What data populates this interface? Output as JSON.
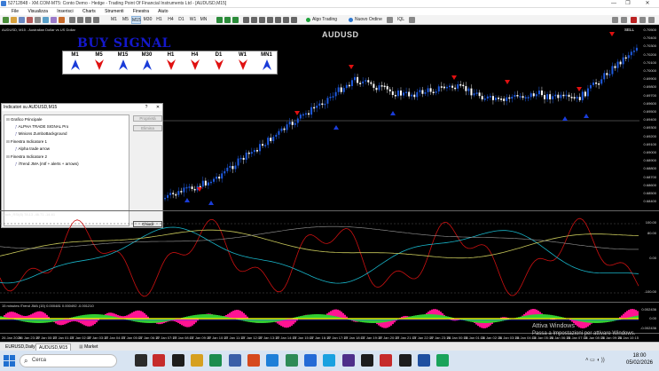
{
  "window": {
    "title": "52712848 - XM.COM-MT5: Conto Demo - Hedge - Trading Point Of Financial Instruments Ltd - [AUDUSD,M15]",
    "buttons": [
      "—",
      "❐",
      "✕"
    ]
  },
  "menu": [
    "File",
    "Visualizza",
    "Inserisci",
    "Charts",
    "Strumenti",
    "Finestra",
    "Aiuto"
  ],
  "toolbar": {
    "timeframes": [
      "M1",
      "M5",
      "M15",
      "M30",
      "H1",
      "H4",
      "D1",
      "W1",
      "MN"
    ],
    "active": "M15",
    "algo": "Algo Trading",
    "new_order": "Nuovo Ordine",
    "iql": "IQL"
  },
  "chart": {
    "title": "AUDUSD, M15 - Australian Dollar vs US Dollar",
    "watermark": "AUDUSD",
    "sell_label": "SELL",
    "buy_signal": "BUY SIGNAL",
    "prices": [
      "0.70500",
      "0.70400",
      "0.70300",
      "0.70200",
      "0.70100",
      "0.70000",
      "0.69900",
      "0.69800",
      "0.69700",
      "0.69600",
      "0.69500",
      "0.69400",
      "0.69300",
      "0.69200",
      "0.69100",
      "0.69000",
      "0.68900",
      "0.68800",
      "0.68700",
      "0.68600",
      "0.68500",
      "0.68400"
    ],
    "signal_tfs": [
      {
        "tf": "M1",
        "dir": "up"
      },
      {
        "tf": "M5",
        "dir": "down"
      },
      {
        "tf": "M15",
        "dir": "up"
      },
      {
        "tf": "M30",
        "dir": "up"
      },
      {
        "tf": "H1",
        "dir": "down"
      },
      {
        "tf": "H4",
        "dir": "down"
      },
      {
        "tf": "D1",
        "dir": "down"
      },
      {
        "tf": "W1",
        "dir": "down"
      },
      {
        "tf": "MN1",
        "dir": "up"
      }
    ],
    "colors": {
      "up": "#1a3cd8",
      "down": "#e01010",
      "candle_up": "#1e5adf",
      "candle_down": "#ffffff"
    }
  },
  "dialog": {
    "title": "Indicatori su AUDUSD,M15",
    "help": "?",
    "close": "✕",
    "tree": [
      {
        "label": "Grafico Principale",
        "level": 0
      },
      {
        "label": "ALPHA TRADE SIGNAL Pro",
        "level": 1
      },
      {
        "label": "Minions ZumboBackground",
        "level": 1
      },
      {
        "label": "Finestra Indicatore 1",
        "level": 0
      },
      {
        "label": "Alpha trade arrow",
        "level": 1
      },
      {
        "label": "Finestra Indicatore 2",
        "level": 0
      },
      {
        "label": "iTrend JMA (mtf + alerts + arrows)",
        "level": 1
      }
    ],
    "buttons": {
      "properties": "Proprietà",
      "remove": "Elimina",
      "close": "Chiudi"
    }
  },
  "sub1": {
    "title": "Stoch_RSI(8) 78.13 -46.71 -14.61",
    "levels": [
      "100.00",
      "80.00",
      "0.00",
      "-100.00"
    ]
  },
  "sub2": {
    "title": "15 minutes iTrend JMA (15) 0.000481 0.000492 -0.001210",
    "levels": [
      "0.002436",
      "0.00",
      "-0.002436"
    ]
  },
  "xaxis": [
    "26 Jan 2026",
    "26 Jan 23:15",
    "27 Jan 00:15",
    "27 Jan 01:15",
    "27 Jan 02:15",
    "27 Jan 03:15",
    "27 Jan 04:15",
    "27 Jan 05:15",
    "27 Jan 06:15",
    "27 Jan 07:15",
    "27 Jan 08:15",
    "27 Jan 09:15",
    "27 Jan 10:15",
    "27 Jan 11:15",
    "27 Jan 12:15",
    "27 Jan 13:15",
    "27 Jan 14:15",
    "27 Jan 15:15",
    "27 Jan 16:15",
    "27 Jan 17:15",
    "27 Jan 18:15",
    "27 Jan 19:15",
    "27 Jan 20:15",
    "27 Jan 21:15",
    "27 Jan 22:15",
    "27 Jan 23:15",
    "28 Jan 00:15",
    "28 Jan 01:15",
    "28 Jan 02:15",
    "28 Jan 03:15",
    "28 Jan 04:15",
    "28 Jan 05:15",
    "28 Jan 06:15",
    "28 Jan 07:15",
    "28 Jan 08:15",
    "28 Jan 09:15",
    "28 Jan 10:15"
  ],
  "tabs": [
    "EURUSD,Daily",
    "AUDUSD,M15",
    "Market"
  ],
  "activation": {
    "line1": "Attiva Windows",
    "line2": "Passa a Impostazioni per attivare Windows."
  },
  "taskbar": {
    "search": "Cerca",
    "time": "18:00",
    "date": "05/02/2026"
  }
}
